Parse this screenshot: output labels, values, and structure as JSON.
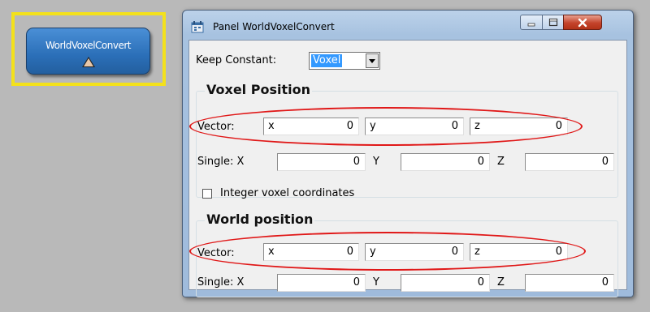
{
  "node": {
    "label": "WorldVoxelConvert"
  },
  "window": {
    "title": "Panel WorldVoxelConvert",
    "min_label": "–",
    "max_label": "▢",
    "close_label": "✕"
  },
  "keep_constant": {
    "label": "Keep Constant:",
    "value": "Voxel"
  },
  "voxel_position": {
    "title": "Voxel Position",
    "vector_label": "Vector:",
    "vector": [
      {
        "axis": "x",
        "value": "0"
      },
      {
        "axis": "y",
        "value": "0"
      },
      {
        "axis": "z",
        "value": "0"
      }
    ],
    "single_label": "Single: X",
    "single_y_label": "Y",
    "single_z_label": "Z",
    "single": [
      "0",
      "0",
      "0"
    ],
    "integer_label": "Integer voxel coordinates"
  },
  "world_position": {
    "title": "World position",
    "vector_label": "Vector:",
    "vector": [
      {
        "axis": "x",
        "value": "0"
      },
      {
        "axis": "y",
        "value": "0"
      },
      {
        "axis": "z",
        "value": "0"
      }
    ],
    "single_label": "Single: X",
    "single_y_label": "Y",
    "single_z_label": "Z",
    "single": [
      "0",
      "0",
      "0"
    ]
  },
  "colors": {
    "highlight_frame": "#f3e11b",
    "annotation_oval": "#e01818",
    "node_blue": "#2b6fb8"
  }
}
